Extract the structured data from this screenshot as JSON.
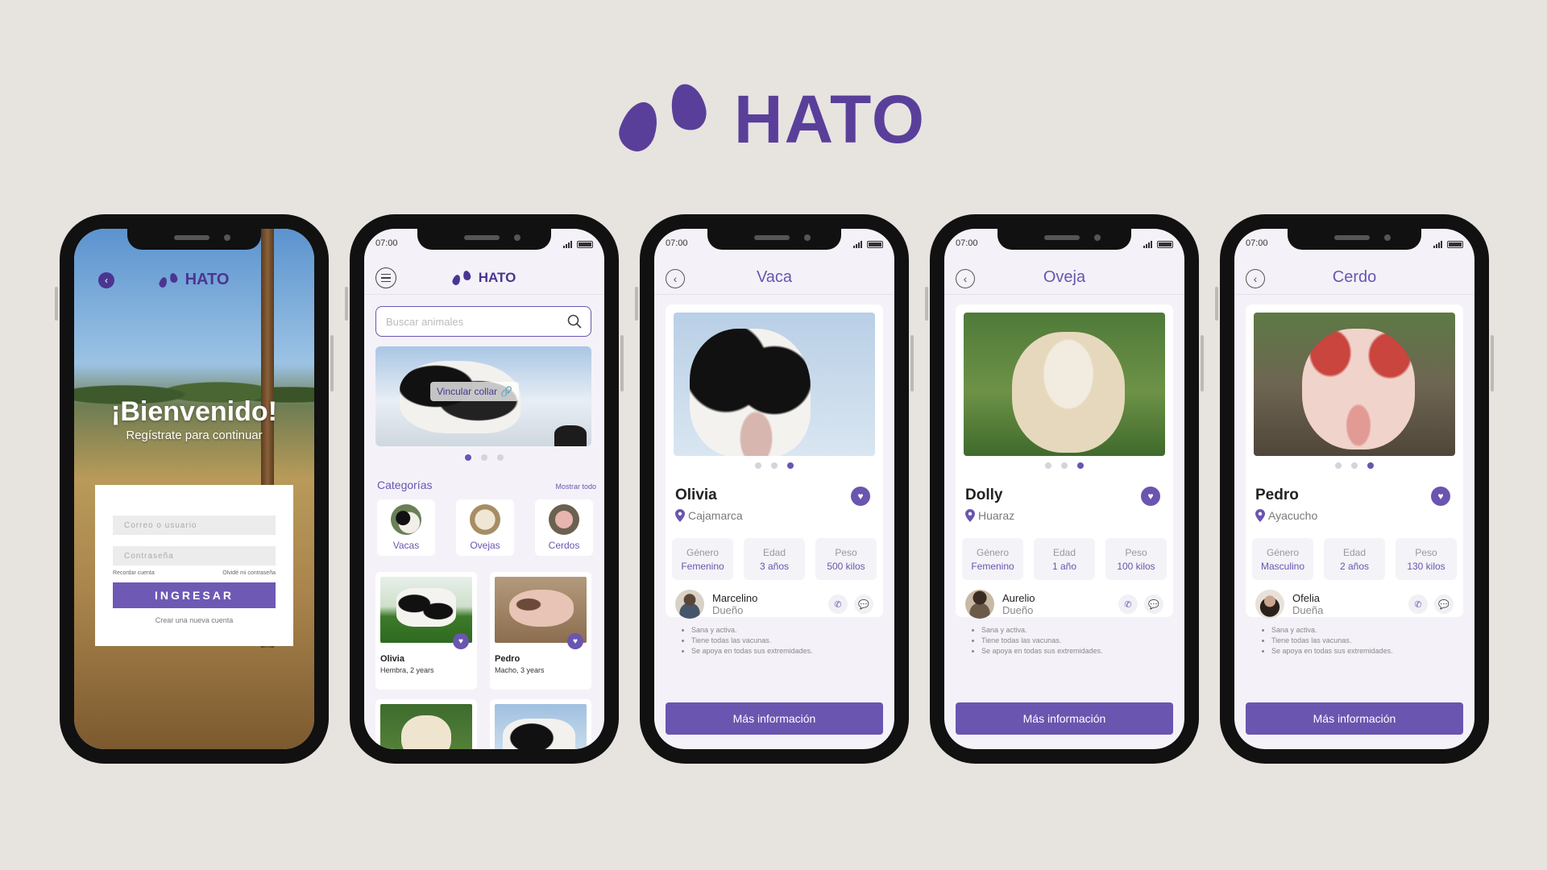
{
  "brand": {
    "name": "HATO",
    "color": "#5a3f9a"
  },
  "colors": {
    "accent": "#6a55b0",
    "background": "#e7e3df"
  },
  "login": {
    "brand": "HATO",
    "welcome": "¡Bienvenido!",
    "subtitle": "Regístrate para continuar",
    "email_placeholder": "Correo o usuario",
    "password_placeholder": "Contraseña",
    "remember": "Recordar cuenta",
    "forgot": "Olvidé mi contraseña",
    "submit": "INGRESAR",
    "create": "Crear una nueva cuenta"
  },
  "home": {
    "time": "07:00",
    "brand": "HATO",
    "search_placeholder": "Buscar animales",
    "hero_badge": "Vincular collar",
    "categories_title": "Categorías",
    "show_all": "Mostrar todo",
    "categories": [
      {
        "label": "Vacas"
      },
      {
        "label": "Ovejas"
      },
      {
        "label": "Cerdos"
      }
    ],
    "cards": [
      {
        "name": "Olivia",
        "desc": "Hembra, 2 years"
      },
      {
        "name": "Pedro",
        "desc": "Macho, 3 years"
      }
    ]
  },
  "details": [
    {
      "time": "07:00",
      "title": "Vaca",
      "name": "Olivia",
      "location": "Cajamarca",
      "stats": [
        {
          "k": "Género",
          "v": "Femenino"
        },
        {
          "k": "Edad",
          "v": "3 años"
        },
        {
          "k": "Peso",
          "v": "500 kilos"
        }
      ],
      "owner": "Marcelino",
      "role": "Dueño",
      "notes": [
        "Sana y activa.",
        "Tiene todas las vacunas.",
        "Se apoya en todas sus extremidades."
      ],
      "button": "Más información"
    },
    {
      "time": "07:00",
      "title": "Oveja",
      "name": "Dolly",
      "location": "Huaraz",
      "stats": [
        {
          "k": "Género",
          "v": "Femenino"
        },
        {
          "k": "Edad",
          "v": "1 año"
        },
        {
          "k": "Peso",
          "v": "100 kilos"
        }
      ],
      "owner": "Aurelio",
      "role": "Dueño",
      "notes": [
        "Sana y activa.",
        "Tiene todas las vacunas.",
        "Se apoya en todas sus extremidades."
      ],
      "button": "Más información"
    },
    {
      "time": "07:00",
      "title": "Cerdo",
      "name": "Pedro",
      "location": "Ayacucho",
      "stats": [
        {
          "k": "Género",
          "v": "Masculino"
        },
        {
          "k": "Edad",
          "v": "2 años"
        },
        {
          "k": "Peso",
          "v": "130 kilos"
        }
      ],
      "owner": "Ofelia",
      "role": "Dueña",
      "notes": [
        "Sana y activa.",
        "Tiene todas las vacunas.",
        "Se apoya en todas sus extremidades."
      ],
      "button": "Más información"
    }
  ]
}
